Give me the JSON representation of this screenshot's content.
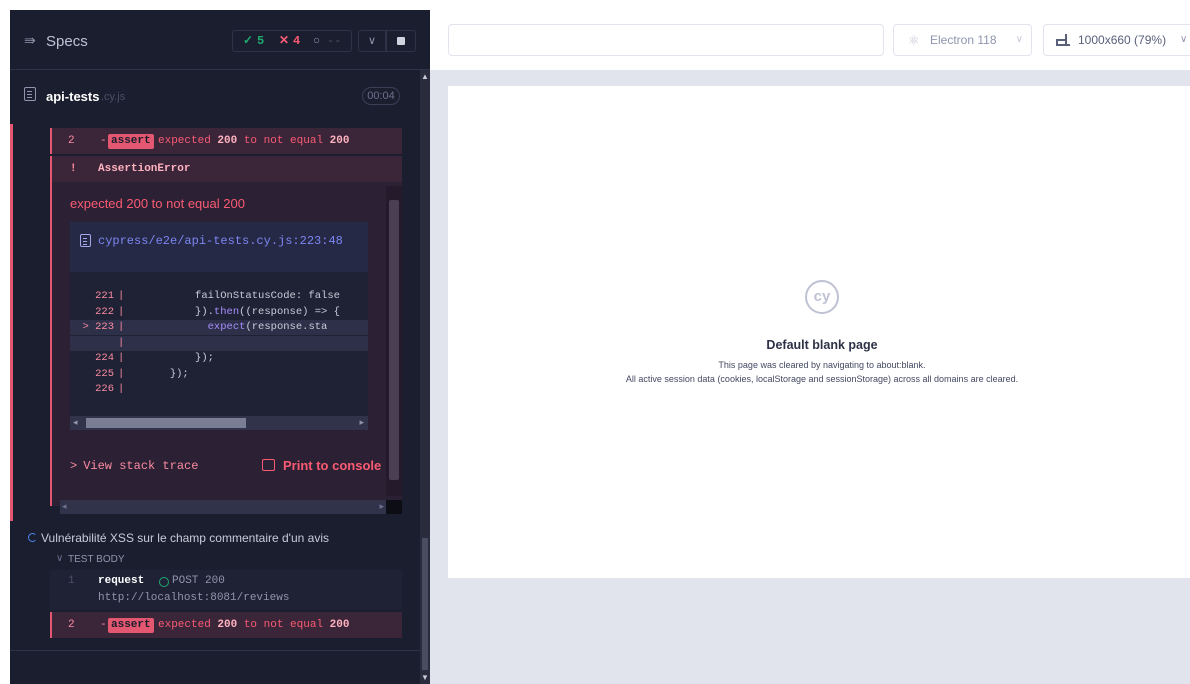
{
  "reporter": {
    "header": {
      "specs_icon": "arrow-right-bar-icon",
      "specs_label": "Specs",
      "stats": {
        "passed": "5",
        "failed": "4",
        "pending": "--"
      },
      "dropdown_icon": "chevron-down-icon",
      "stop_icon": "stop-icon"
    },
    "spec": {
      "name": "api-tests",
      "ext": ".cy.js",
      "duration": "00:04"
    },
    "commands": {
      "failed_assert": {
        "num": "2",
        "dash": "-",
        "badge": "assert",
        "pre": "expected ",
        "v1": "200",
        "mid": " to not equal ",
        "v2": "200"
      }
    },
    "error": {
      "bang": "!",
      "name": "AssertionError",
      "message": "expected 200 to not equal 200",
      "file_path": "cypress/e2e/api-tests.cy.js:223:48",
      "code_lines": [
        {
          "ln": "221",
          "gutter": "|",
          "indent": "          ",
          "pre": "failOnStatusCode: false",
          "kw": "",
          "post": "",
          "hl": false
        },
        {
          "ln": "222",
          "gutter": "|",
          "indent": "          ",
          "pre": "}).",
          "kw": "then",
          "post": "((response) => {",
          "hl": false
        },
        {
          "ln": "> 223",
          "gutter": "|",
          "indent": "            ",
          "pre": "",
          "kw": "expect",
          "post": "(response.sta",
          "hl": true
        },
        {
          "ln": "",
          "gutter": "|",
          "indent": "",
          "pre": "",
          "kw": "",
          "post": "",
          "hl": true
        },
        {
          "ln": "224",
          "gutter": "|",
          "indent": "          ",
          "pre": "});",
          "kw": "",
          "post": "",
          "hl": false
        },
        {
          "ln": "225",
          "gutter": "|",
          "indent": "      ",
          "pre": "});",
          "kw": "",
          "post": "",
          "hl": false
        },
        {
          "ln": "226",
          "gutter": "|",
          "indent": "",
          "pre": "",
          "kw": "",
          "post": "",
          "hl": false
        }
      ],
      "stack_chevron": ">",
      "stack_label": "View stack trace",
      "print_label": "Print to console"
    },
    "pending_test": {
      "title": "Vulnérabilité XSS sur le champ commentaire d'un avis",
      "body_label": "TEST BODY",
      "request": {
        "num": "1",
        "cmd": "request",
        "status": "POST 200",
        "url": "http://localhost:8081/reviews"
      },
      "assert": {
        "num": "2",
        "dash": "-",
        "badge": "assert",
        "pre": "expected ",
        "v1": "200",
        "mid": " to not equal ",
        "v2": "200"
      }
    }
  },
  "toolbar": {
    "url": "",
    "browser_label": "Electron 118",
    "browser_icon": "electron-icon",
    "viewport_label": "1000x660 (79%)",
    "viewport_icon": "viewport-icon"
  },
  "blank_page": {
    "logo": "cy",
    "title": "Default blank page",
    "line1": "This page was cleared by navigating to about:blank.",
    "line2": "All active session data (cookies, localStorage and sessionStorage) across all domains are cleared."
  }
}
